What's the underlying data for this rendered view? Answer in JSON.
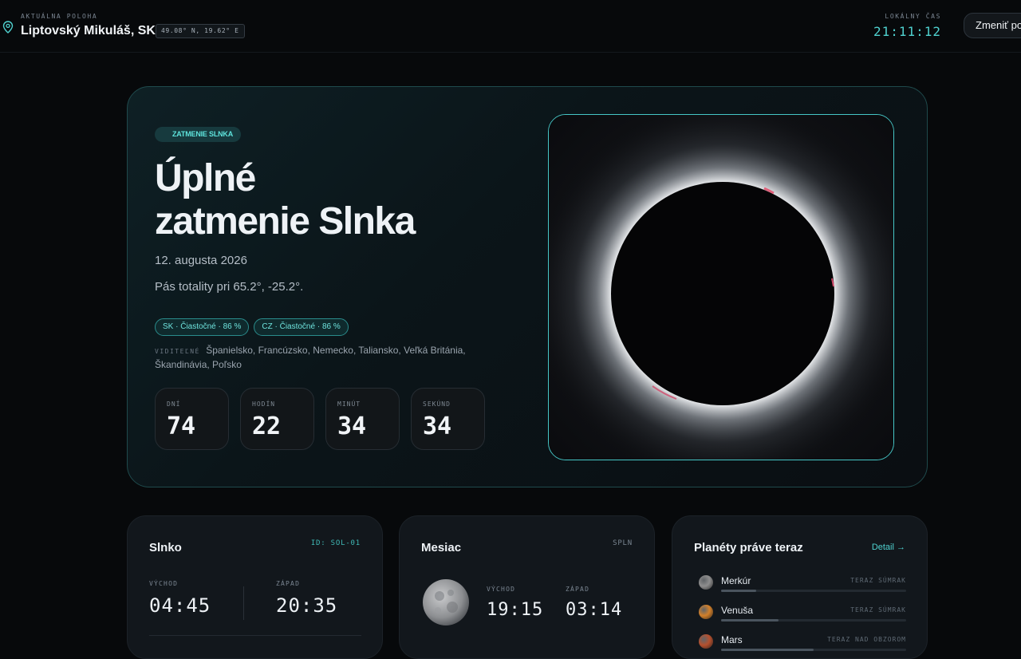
{
  "header": {
    "location_caption": "AKTUÁLNA POLOHA",
    "location_name": "Liptovský Mikuláš, SK",
    "coordinates": "49.08° N, 19.62° E",
    "time_caption": "LOKÁLNY ČAS",
    "time_value": "21:11:12",
    "change_button": "Zmeniť polohu"
  },
  "hero": {
    "badge": "ZATMENIE SLNKA",
    "title_line1": "Úplné",
    "title_line2": "zatmenie Slnka",
    "date": "12. augusta 2026",
    "path": "Pás totality pri 65.2°, -25.2°.",
    "tags": [
      "SK · Čiastočné · 86 %",
      "CZ · Čiastočné · 86 %"
    ],
    "visible_caption": "VIDITEĽNÉ",
    "visible_list": "Španielsko, Francúzsko, Nemecko, Taliansko, Veľká Británia, Škandinávia, Poľsko",
    "countdown": [
      {
        "label": "DNÍ",
        "value": "74"
      },
      {
        "label": "HODÍN",
        "value": "22"
      },
      {
        "label": "MINÚT",
        "value": "34"
      },
      {
        "label": "SEKÚND",
        "value": "34"
      }
    ]
  },
  "sun": {
    "title": "Slnko",
    "id": "ID: SOL-01",
    "rise_label": "VÝCHOD",
    "rise": "04:45",
    "set_label": "ZÁPAD",
    "set": "20:35"
  },
  "moon": {
    "title": "Mesiac",
    "phase": "SPLN",
    "rise_label": "VÝCHOD",
    "rise": "19:15",
    "set_label": "ZÁPAD",
    "set": "03:14"
  },
  "planets": {
    "title": "Planéty práve teraz",
    "detail": "Detail →",
    "items": [
      {
        "name": "Merkúr",
        "status": "TERAZ SÚMRAK",
        "color": "#8e8e8e",
        "level": 0.19
      },
      {
        "name": "Venuša",
        "status": "TERAZ SÚMRAK",
        "color": "#d2802a",
        "level": 0.31
      },
      {
        "name": "Mars",
        "status": "TERAZ NAD OBZOROM",
        "color": "#b5502e",
        "level": 0.5
      }
    ]
  },
  "colors": {
    "accent": "#4fd1cf",
    "background": "#07090b"
  }
}
